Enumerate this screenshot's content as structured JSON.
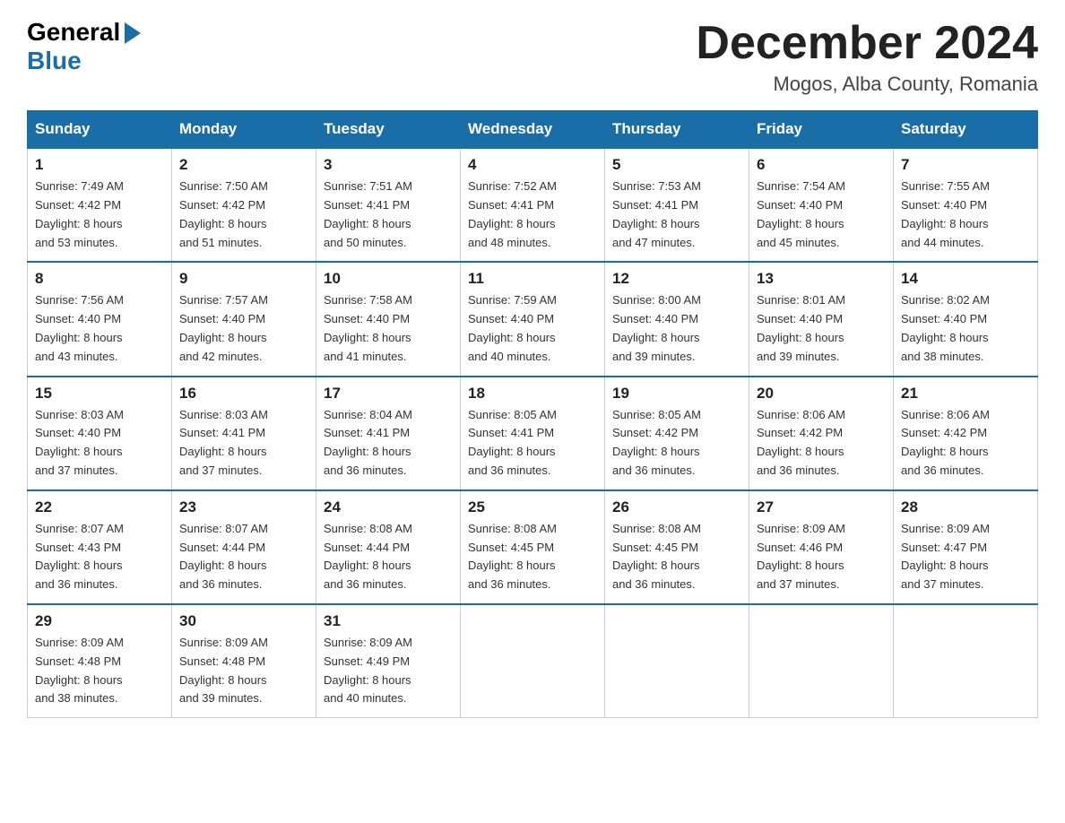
{
  "header": {
    "logo_general": "General",
    "logo_blue": "Blue",
    "month_title": "December 2024",
    "location": "Mogos, Alba County, Romania"
  },
  "weekdays": [
    "Sunday",
    "Monday",
    "Tuesday",
    "Wednesday",
    "Thursday",
    "Friday",
    "Saturday"
  ],
  "weeks": [
    [
      {
        "day": "1",
        "sunrise": "7:49 AM",
        "sunset": "4:42 PM",
        "daylight": "8 hours and 53 minutes."
      },
      {
        "day": "2",
        "sunrise": "7:50 AM",
        "sunset": "4:42 PM",
        "daylight": "8 hours and 51 minutes."
      },
      {
        "day": "3",
        "sunrise": "7:51 AM",
        "sunset": "4:41 PM",
        "daylight": "8 hours and 50 minutes."
      },
      {
        "day": "4",
        "sunrise": "7:52 AM",
        "sunset": "4:41 PM",
        "daylight": "8 hours and 48 minutes."
      },
      {
        "day": "5",
        "sunrise": "7:53 AM",
        "sunset": "4:41 PM",
        "daylight": "8 hours and 47 minutes."
      },
      {
        "day": "6",
        "sunrise": "7:54 AM",
        "sunset": "4:40 PM",
        "daylight": "8 hours and 45 minutes."
      },
      {
        "day": "7",
        "sunrise": "7:55 AM",
        "sunset": "4:40 PM",
        "daylight": "8 hours and 44 minutes."
      }
    ],
    [
      {
        "day": "8",
        "sunrise": "7:56 AM",
        "sunset": "4:40 PM",
        "daylight": "8 hours and 43 minutes."
      },
      {
        "day": "9",
        "sunrise": "7:57 AM",
        "sunset": "4:40 PM",
        "daylight": "8 hours and 42 minutes."
      },
      {
        "day": "10",
        "sunrise": "7:58 AM",
        "sunset": "4:40 PM",
        "daylight": "8 hours and 41 minutes."
      },
      {
        "day": "11",
        "sunrise": "7:59 AM",
        "sunset": "4:40 PM",
        "daylight": "8 hours and 40 minutes."
      },
      {
        "day": "12",
        "sunrise": "8:00 AM",
        "sunset": "4:40 PM",
        "daylight": "8 hours and 39 minutes."
      },
      {
        "day": "13",
        "sunrise": "8:01 AM",
        "sunset": "4:40 PM",
        "daylight": "8 hours and 39 minutes."
      },
      {
        "day": "14",
        "sunrise": "8:02 AM",
        "sunset": "4:40 PM",
        "daylight": "8 hours and 38 minutes."
      }
    ],
    [
      {
        "day": "15",
        "sunrise": "8:03 AM",
        "sunset": "4:40 PM",
        "daylight": "8 hours and 37 minutes."
      },
      {
        "day": "16",
        "sunrise": "8:03 AM",
        "sunset": "4:41 PM",
        "daylight": "8 hours and 37 minutes."
      },
      {
        "day": "17",
        "sunrise": "8:04 AM",
        "sunset": "4:41 PM",
        "daylight": "8 hours and 36 minutes."
      },
      {
        "day": "18",
        "sunrise": "8:05 AM",
        "sunset": "4:41 PM",
        "daylight": "8 hours and 36 minutes."
      },
      {
        "day": "19",
        "sunrise": "8:05 AM",
        "sunset": "4:42 PM",
        "daylight": "8 hours and 36 minutes."
      },
      {
        "day": "20",
        "sunrise": "8:06 AM",
        "sunset": "4:42 PM",
        "daylight": "8 hours and 36 minutes."
      },
      {
        "day": "21",
        "sunrise": "8:06 AM",
        "sunset": "4:42 PM",
        "daylight": "8 hours and 36 minutes."
      }
    ],
    [
      {
        "day": "22",
        "sunrise": "8:07 AM",
        "sunset": "4:43 PM",
        "daylight": "8 hours and 36 minutes."
      },
      {
        "day": "23",
        "sunrise": "8:07 AM",
        "sunset": "4:44 PM",
        "daylight": "8 hours and 36 minutes."
      },
      {
        "day": "24",
        "sunrise": "8:08 AM",
        "sunset": "4:44 PM",
        "daylight": "8 hours and 36 minutes."
      },
      {
        "day": "25",
        "sunrise": "8:08 AM",
        "sunset": "4:45 PM",
        "daylight": "8 hours and 36 minutes."
      },
      {
        "day": "26",
        "sunrise": "8:08 AM",
        "sunset": "4:45 PM",
        "daylight": "8 hours and 36 minutes."
      },
      {
        "day": "27",
        "sunrise": "8:09 AM",
        "sunset": "4:46 PM",
        "daylight": "8 hours and 37 minutes."
      },
      {
        "day": "28",
        "sunrise": "8:09 AM",
        "sunset": "4:47 PM",
        "daylight": "8 hours and 37 minutes."
      }
    ],
    [
      {
        "day": "29",
        "sunrise": "8:09 AM",
        "sunset": "4:48 PM",
        "daylight": "8 hours and 38 minutes."
      },
      {
        "day": "30",
        "sunrise": "8:09 AM",
        "sunset": "4:48 PM",
        "daylight": "8 hours and 39 minutes."
      },
      {
        "day": "31",
        "sunrise": "8:09 AM",
        "sunset": "4:49 PM",
        "daylight": "8 hours and 40 minutes."
      },
      null,
      null,
      null,
      null
    ]
  ],
  "labels": {
    "sunrise": "Sunrise:",
    "sunset": "Sunset:",
    "daylight": "Daylight:"
  }
}
